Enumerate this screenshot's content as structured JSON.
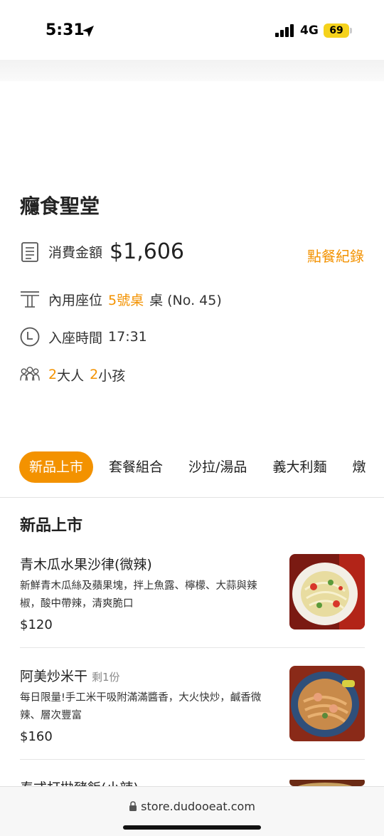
{
  "status": {
    "time": "5:31",
    "network": "4G",
    "battery": "69"
  },
  "store": {
    "name": "癮食聖堂",
    "amount_label": "消費金額",
    "amount": "$1,606",
    "order_record": "點餐紀錄",
    "seat_label": "內用座位",
    "seat_table": "5號桌",
    "seat_suffix": "桌 (No. 45)",
    "time_label": "入座時間",
    "time_value": "17:31",
    "adults_count": "2",
    "adults_label": "大人",
    "kids_count": "2",
    "kids_label": "小孩"
  },
  "tabs": [
    {
      "label": "新品上市",
      "active": true
    },
    {
      "label": "套餐組合"
    },
    {
      "label": "沙拉/湯品"
    },
    {
      "label": "義大利麵"
    },
    {
      "label": "燉"
    }
  ],
  "section_title": "新品上市",
  "items": [
    {
      "name": "青木瓜水果沙律(微辣)",
      "remain": "",
      "desc": "新鮮青木瓜絲及蘋果塊，拌上魚露、檸檬、大蒜與辣椒，酸中帶辣，清爽脆口",
      "price": "$120"
    },
    {
      "name": "阿美炒米干",
      "remain": "剩1份",
      "desc": "每日限量!手工米干吸附滿滿醬香，大火快炒，鹹香微辣、層次豐富",
      "price": "$160"
    },
    {
      "name": "泰式打拋豬飯(小辣)",
      "remain": "",
      "desc": "",
      "price": ""
    }
  ],
  "browser": {
    "url": "store.dudooeat.com"
  },
  "colors": {
    "accent": "#f39200"
  }
}
